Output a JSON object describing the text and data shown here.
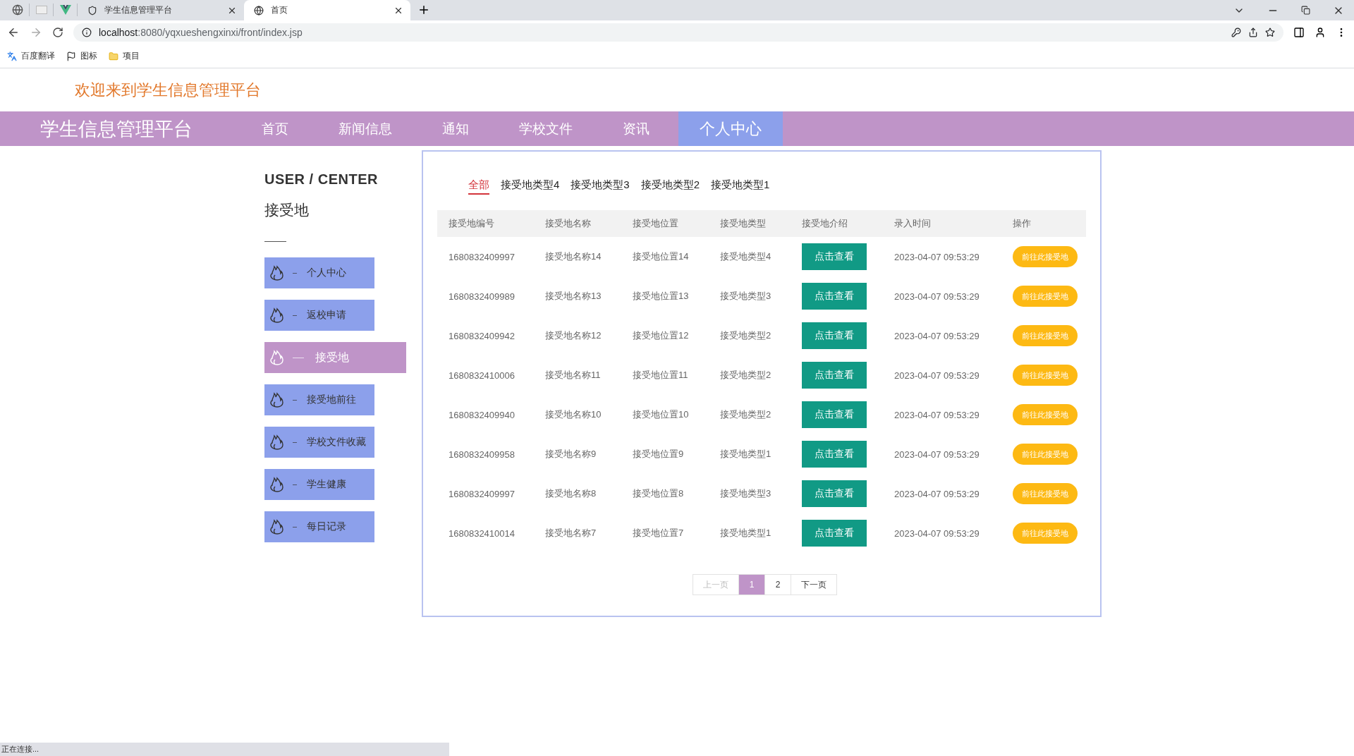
{
  "browser": {
    "tabs": [
      {
        "title": "学生信息管理平台",
        "selected": false
      },
      {
        "title": "首页",
        "selected": true
      }
    ],
    "url_host": "localhost",
    "url_rest": ":8080/yqxueshengxinxi/front/index.jsp",
    "bookmarks": [
      {
        "label": "百度翻译",
        "kind": "translate"
      },
      {
        "label": "图标",
        "kind": "flag"
      },
      {
        "label": "项目",
        "kind": "folder"
      }
    ]
  },
  "site": {
    "welcome": "欢迎来到学生信息管理平台",
    "logo": "学生信息管理平台",
    "nav": [
      {
        "label": "首页",
        "selected": false
      },
      {
        "label": "新闻信息",
        "selected": false
      },
      {
        "label": "通知",
        "selected": false
      },
      {
        "label": "学校文件",
        "selected": false
      },
      {
        "label": "资讯",
        "selected": false
      },
      {
        "label": "个人中心",
        "selected": true
      }
    ]
  },
  "sidebar": {
    "heading": "USER / CENTER",
    "title": "接受地",
    "items": [
      {
        "label": "个人中心",
        "selected": false
      },
      {
        "label": "返校申请",
        "selected": false
      },
      {
        "label": "接受地",
        "selected": true
      },
      {
        "label": "接受地前往",
        "selected": false
      },
      {
        "label": "学校文件收藏",
        "selected": false
      },
      {
        "label": "学生健康",
        "selected": false
      },
      {
        "label": "每日记录",
        "selected": false
      }
    ]
  },
  "filters": [
    {
      "label": "全部",
      "selected": true
    },
    {
      "label": "接受地类型4",
      "selected": false
    },
    {
      "label": "接受地类型3",
      "selected": false
    },
    {
      "label": "接受地类型2",
      "selected": false
    },
    {
      "label": "接受地类型1",
      "selected": false
    }
  ],
  "table": {
    "columns": [
      "接受地编号",
      "接受地名称",
      "接受地位置",
      "接受地类型",
      "接受地介绍",
      "录入时间",
      "操作"
    ],
    "rows": [
      {
        "id": "1680832409997",
        "name": "接受地名称14",
        "location": "接受地位置14",
        "type": "接受地类型4",
        "intro": "点击查看",
        "time": "2023-04-07 09:53:29",
        "action": "前往此接受地"
      },
      {
        "id": "1680832409989",
        "name": "接受地名称13",
        "location": "接受地位置13",
        "type": "接受地类型3",
        "intro": "点击查看",
        "time": "2023-04-07 09:53:29",
        "action": "前往此接受地"
      },
      {
        "id": "1680832409942",
        "name": "接受地名称12",
        "location": "接受地位置12",
        "type": "接受地类型2",
        "intro": "点击查看",
        "time": "2023-04-07 09:53:29",
        "action": "前往此接受地"
      },
      {
        "id": "1680832410006",
        "name": "接受地名称11",
        "location": "接受地位置11",
        "type": "接受地类型2",
        "intro": "点击查看",
        "time": "2023-04-07 09:53:29",
        "action": "前往此接受地"
      },
      {
        "id": "1680832409940",
        "name": "接受地名称10",
        "location": "接受地位置10",
        "type": "接受地类型2",
        "intro": "点击查看",
        "time": "2023-04-07 09:53:29",
        "action": "前往此接受地"
      },
      {
        "id": "1680832409958",
        "name": "接受地名称9",
        "location": "接受地位置9",
        "type": "接受地类型1",
        "intro": "点击查看",
        "time": "2023-04-07 09:53:29",
        "action": "前往此接受地"
      },
      {
        "id": "1680832409997",
        "name": "接受地名称8",
        "location": "接受地位置8",
        "type": "接受地类型3",
        "intro": "点击查看",
        "time": "2023-04-07 09:53:29",
        "action": "前往此接受地"
      },
      {
        "id": "1680832410014",
        "name": "接受地名称7",
        "location": "接受地位置7",
        "type": "接受地类型1",
        "intro": "点击查看",
        "time": "2023-04-07 09:53:29",
        "action": "前往此接受地"
      }
    ]
  },
  "pagination": {
    "prev": {
      "label": "上一页",
      "disabled": true
    },
    "pages": [
      {
        "label": "1",
        "selected": true
      },
      {
        "label": "2",
        "selected": false
      }
    ],
    "next": {
      "label": "下一页",
      "disabled": false
    }
  },
  "status": "正在连接..."
}
